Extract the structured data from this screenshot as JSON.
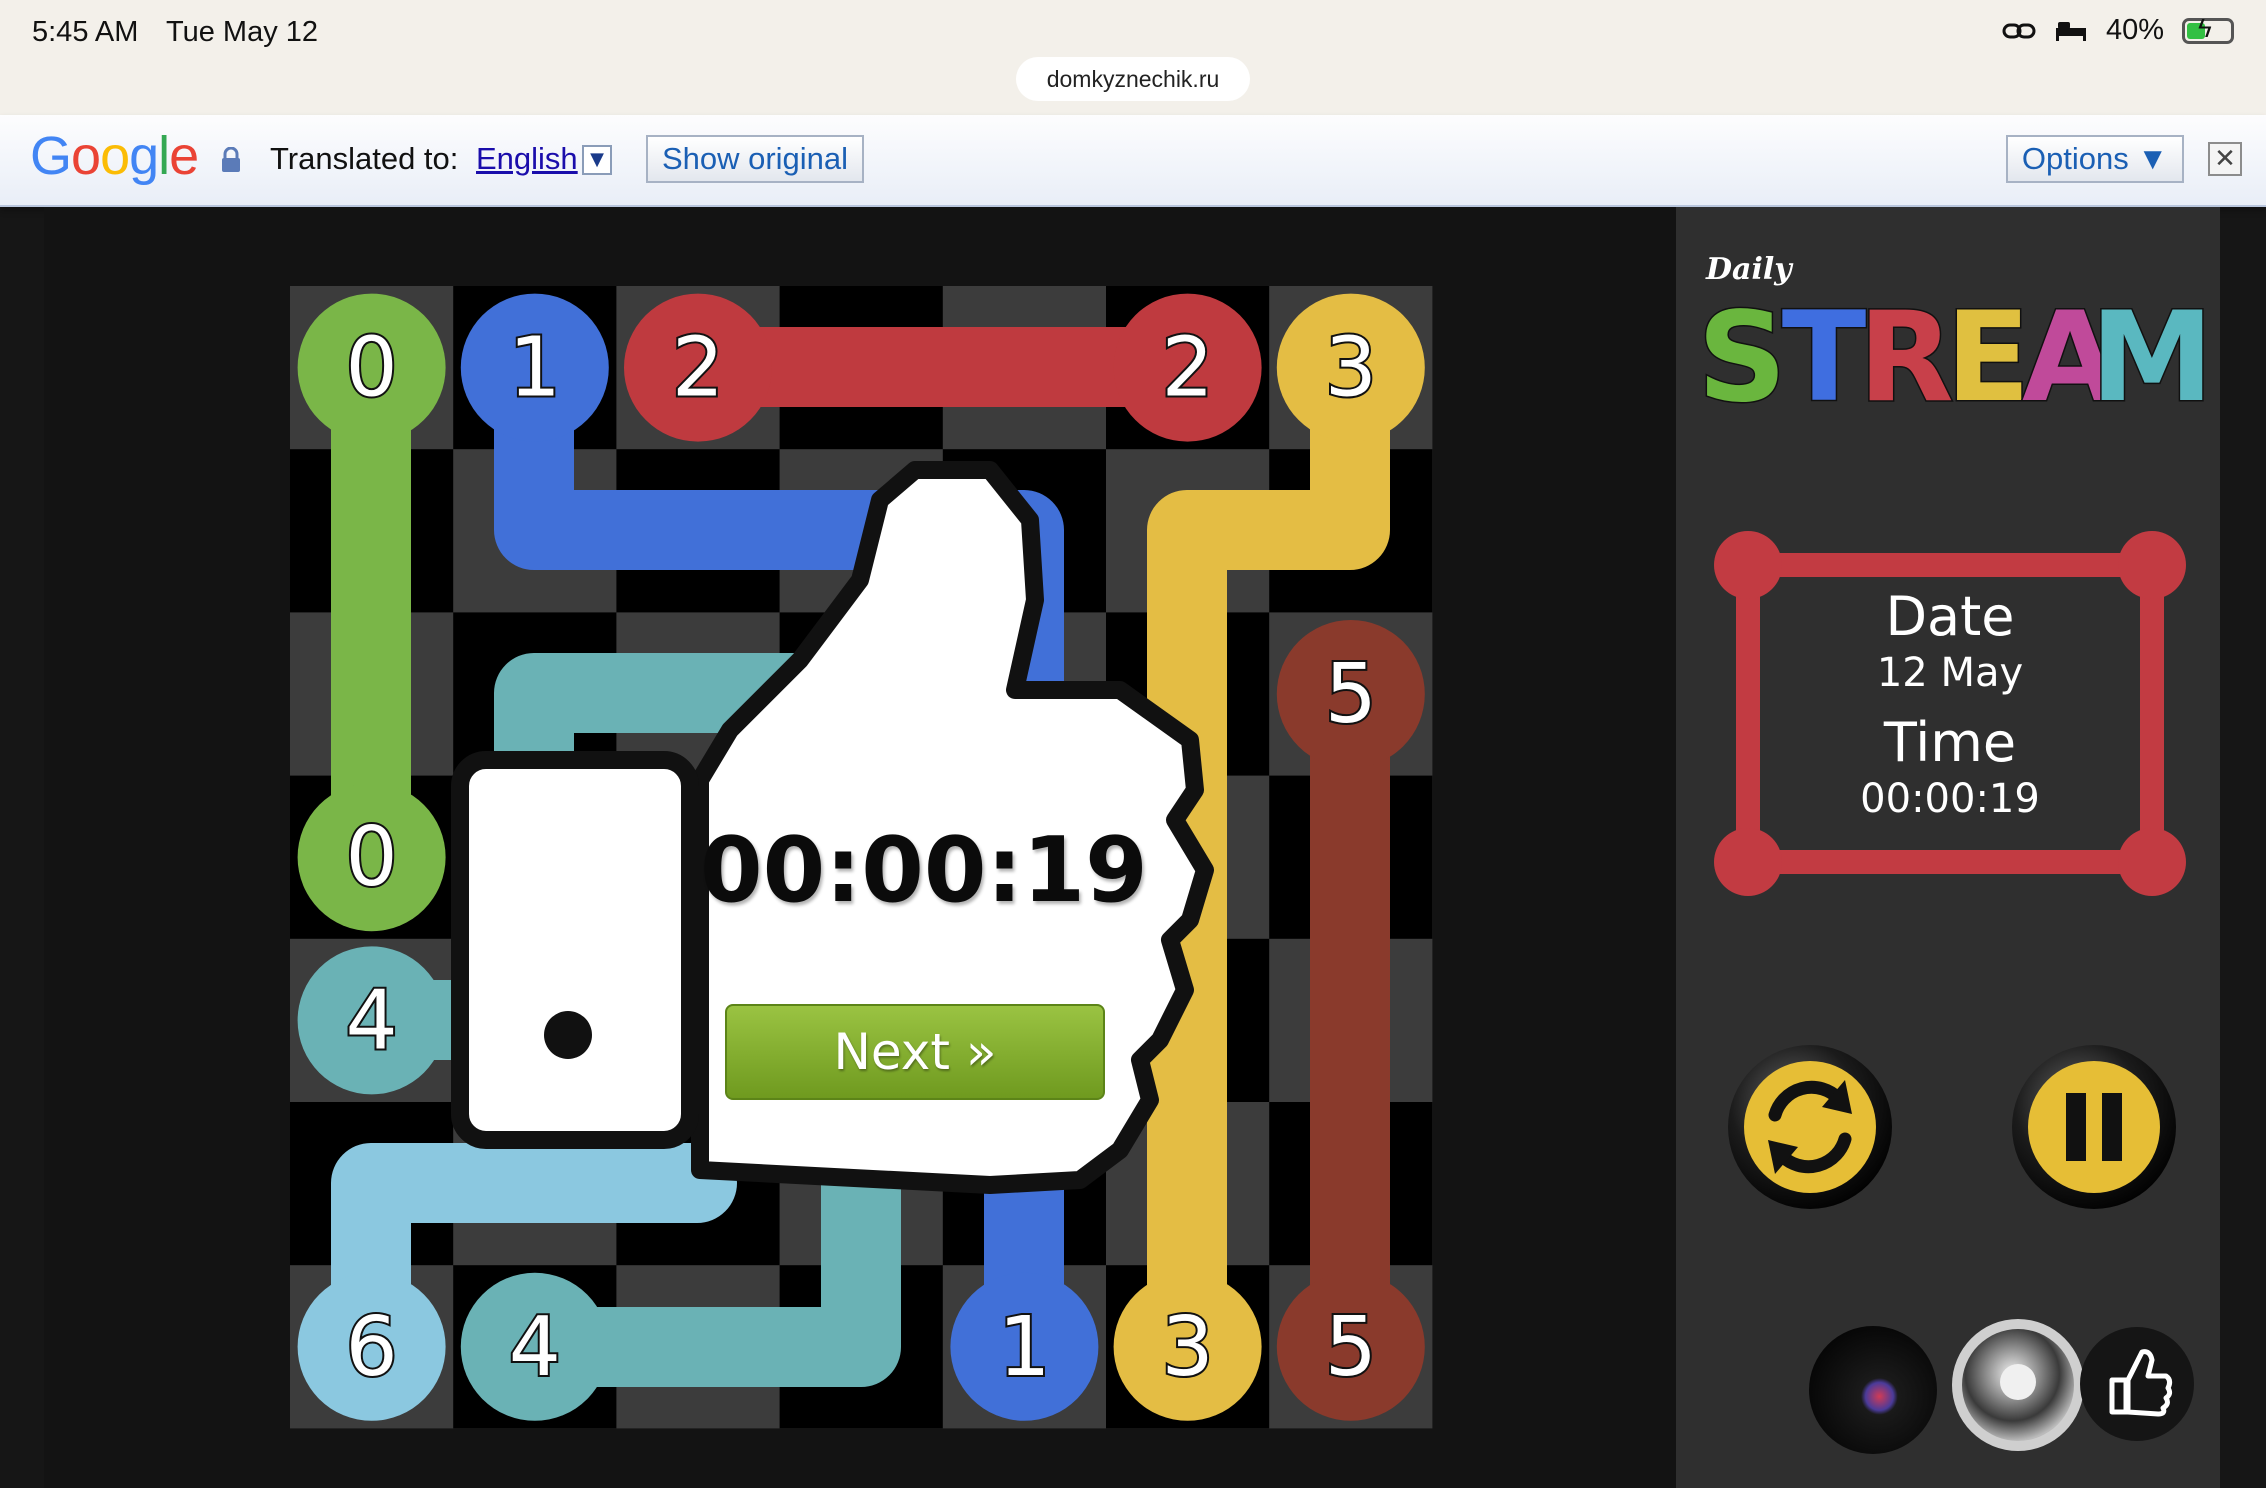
{
  "status_bar": {
    "time": "5:45 AM",
    "date": "Tue May 12",
    "battery": "40%"
  },
  "browser": {
    "url": "domkyznechik.ru"
  },
  "translate_bar": {
    "logo": "Google",
    "label": "Translated to:",
    "language": "English",
    "show_original": "Show original",
    "options": "Options ▼"
  },
  "game": {
    "grid_size": 7,
    "endpoints": [
      {
        "label": "0",
        "color": "#7ab648",
        "row": 0,
        "col": 0
      },
      {
        "label": "0",
        "color": "#7ab648",
        "row": 3,
        "col": 0
      },
      {
        "label": "1",
        "color": "#4170d8",
        "row": 0,
        "col": 1
      },
      {
        "label": "1",
        "color": "#4170d8",
        "row": 6,
        "col": 4
      },
      {
        "label": "2",
        "color": "#bf3a3f",
        "row": 0,
        "col": 2
      },
      {
        "label": "2",
        "color": "#bf3a3f",
        "row": 0,
        "col": 5
      },
      {
        "label": "3",
        "color": "#e4bd44",
        "row": 0,
        "col": 6
      },
      {
        "label": "3",
        "color": "#e4bd44",
        "row": 6,
        "col": 5
      },
      {
        "label": "4",
        "color": "#6ab2b5",
        "row": 4,
        "col": 0
      },
      {
        "label": "4",
        "color": "#6ab2b5",
        "row": 6,
        "col": 1
      },
      {
        "label": "5",
        "color": "#8a3a2c",
        "row": 2,
        "col": 6
      },
      {
        "label": "5",
        "color": "#8a3a2c",
        "row": 6,
        "col": 6
      },
      {
        "label": "6",
        "color": "#8bc8e0",
        "row": 6,
        "col": 0
      }
    ],
    "completion": {
      "time": "00:00:19",
      "next_label": "Next »"
    }
  },
  "sidebar": {
    "logo_small": "Daily",
    "logo_big": "STREAM",
    "logo_colors": [
      "#6ab63e",
      "#3f6ee0",
      "#c8404a",
      "#e0c040",
      "#c04a9a",
      "#5ab8c0"
    ],
    "date_label": "Date",
    "date_value": "12 May",
    "time_label": "Time",
    "time_value": "00:00:19",
    "frame_color": "#c23b42",
    "accent": "#e6be36"
  }
}
